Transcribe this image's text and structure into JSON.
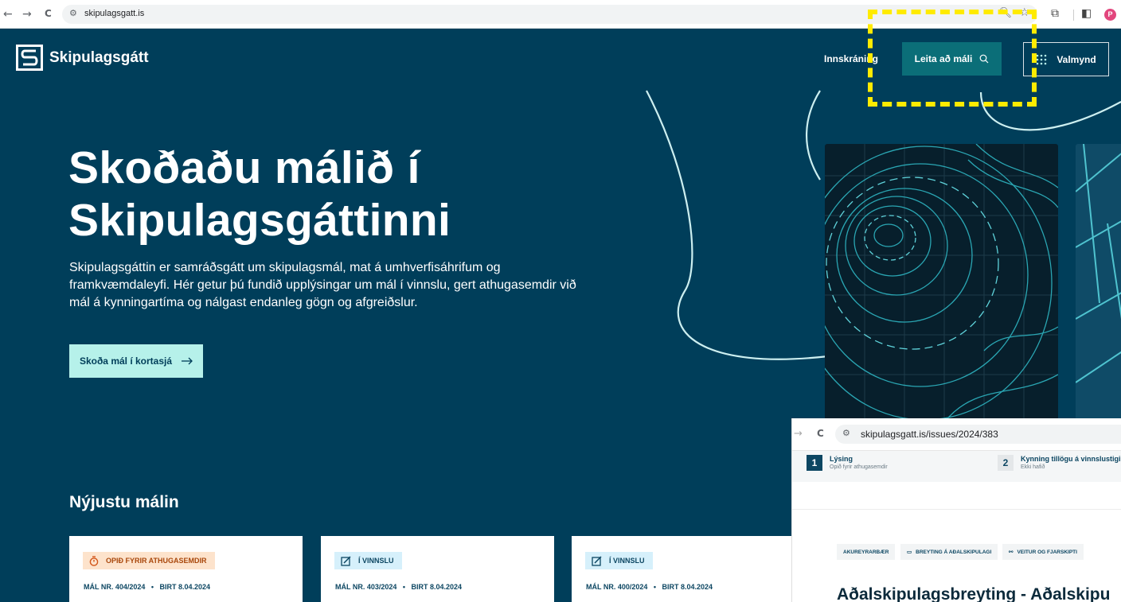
{
  "browser": {
    "back_icon": "←",
    "forward_icon": "→",
    "reload_icon": "C",
    "url": "skipulagsgatt.is",
    "profile_initial": "P"
  },
  "site": {
    "brand": "Skipulagsgátt",
    "nav": {
      "login": "Innskráning",
      "search": "Leita að máli",
      "menu": "Valmynd"
    },
    "hero": {
      "title_line1": "Skoðaðu málið í",
      "title_line2": "Skipulagsgáttinni",
      "text": "Skipulagsgáttin er samráðsgátt um skipulagsmál, mat á umhverfisáhrifum og framkvæmdaleyfi. Hér getur þú fundið upplýsingar um mál í vinnslu, gert athugasemdir við mál á kynningartíma og nálgast endanleg gögn og afgreiðslur.",
      "cta": "Skoða mál í kortasjá"
    },
    "latest": {
      "title": "Nýjustu málin",
      "cards": [
        {
          "status": "OPIÐ FYRIR ATHUGASEMDIR",
          "case": "MÁL NR. 404/2024",
          "published": "BIRT 8.04.2024"
        },
        {
          "status": "Í VINNSLU",
          "case": "MÁL NR. 403/2024",
          "published": "BIRT 8.04.2024"
        },
        {
          "status": "Í VINNSLU",
          "case": "MÁL NR. 400/2024",
          "published": "BIRT 8.04.2024"
        }
      ]
    }
  },
  "overlay": {
    "url": "skipulagsgatt.is/issues/2024/383",
    "steps": [
      {
        "num": "1",
        "title": "Lýsing",
        "sub": "Opið fyrir athugasemdir"
      },
      {
        "num": "2",
        "title": "Kynning tillögu á vinnslustigi",
        "sub": "Ekki hafið"
      }
    ],
    "tags": [
      "AKUREYRARBÆR",
      "BREYTING Á AÐALSKIPULAGI",
      "VEITUR OG FJARSKIPTI"
    ],
    "title": "Aðalskipulagsbreyting - Aðalskipu"
  },
  "colors": {
    "brand_bg": "#003e5a",
    "search_btn": "#0b6e78",
    "cta_bg": "#b6f1ea",
    "open_badge": "#fde3cc",
    "process_badge": "#d6f0fb",
    "annotation": "#ffeb00"
  }
}
